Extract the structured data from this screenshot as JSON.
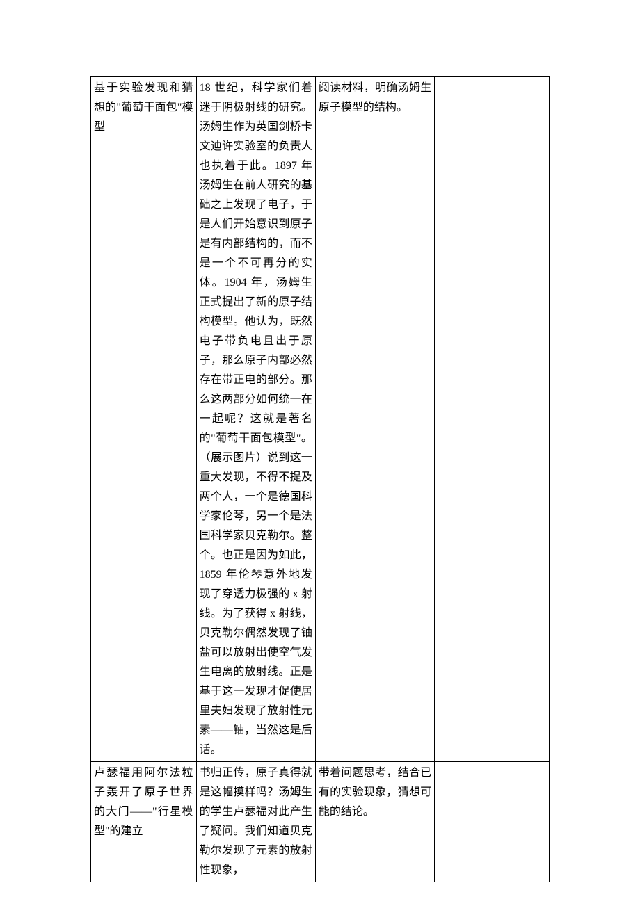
{
  "rows": [
    {
      "col1": "基于实验发现和猜想的\"葡萄干面包\"模型",
      "col2": "18 世纪，科学家们着迷于阴极射线的研究。汤姆生作为英国剑桥卡文迪许实验室的负责人也执着于此。1897 年汤姆生在前人研究的基础之上发现了电子，于是人们开始意识到原子是有内部结构的，而不是一个不可再分的实体。1904 年，汤姆生正式提出了新的原子结构模型。他认为，既然电子带负电且出于原子，那么原子内部必然存在带正电的部分。那么这两部分如何统一在一起呢？这就是著名的\"葡萄干面包模型\"。（展示图片）说到这一重大发现，不得不提及两个人，一个是德国科学家伦琴，另一个是法国科学家贝克勒尔。整个。也正是因为如此，1859 年伦琴意外地发现了穿透力极强的 x 射线。为了获得 x 射线，贝克勒尔偶然发现了铀盐可以放射出使空气发生电离的放射线。正是基于这一发现才促使居里夫妇发现了放射性元素——铀，当然这是后话。",
      "col3": "阅读材料，明确汤姆生原子模型的结构。",
      "col4": ""
    },
    {
      "col1": "卢瑟福用阿尔法粒子轰开了原子世界的大门——\"行星模型\"的建立",
      "col2": "书归正传，原子真得就是这幅摸样吗？汤姆生的学生卢瑟福对此产生了疑问。我们知道贝克勒尔发现了元素的放射性现象，",
      "col3": "带着问题思考，结合已有的实验现象，猜想可能的结论。",
      "col4": ""
    }
  ]
}
